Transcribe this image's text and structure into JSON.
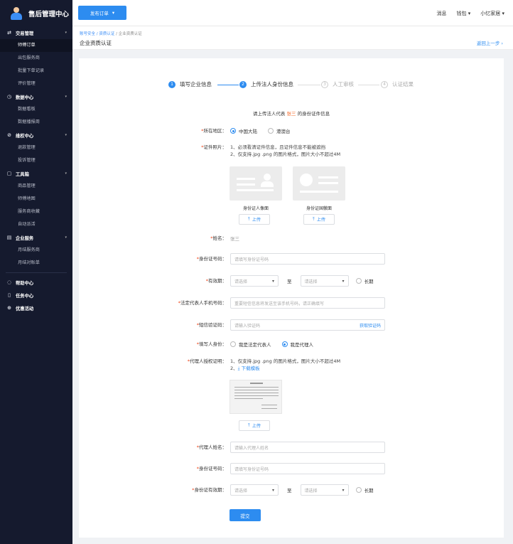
{
  "app_title": "售后管理中心",
  "sidebar": {
    "groups": [
      {
        "icon": "⇄",
        "label": "交易管理",
        "items": [
          "师傅订单",
          "出包服务商",
          "批量下单记录",
          "评价管理"
        ]
      },
      {
        "icon": "◷",
        "label": "数据中心",
        "items": [
          "数据看板",
          "数据播报周"
        ]
      },
      {
        "icon": "⊘",
        "label": "维权中心",
        "items": [
          "退款管理",
          "投诉管理"
        ]
      },
      {
        "icon": "▢",
        "label": "工具箱",
        "items": [
          "商品管理",
          "师傅地图",
          "服务商收藏",
          "自动派活"
        ]
      },
      {
        "icon": "▤",
        "label": "企业服务",
        "items": [
          "月结服务商",
          "月结对账单"
        ]
      }
    ],
    "extra": [
      {
        "icon": "◌",
        "label": "帮助中心"
      },
      {
        "icon": "▯",
        "label": "任务中心"
      },
      {
        "icon": "⊕",
        "label": "优惠活动"
      }
    ]
  },
  "topbar": {
    "publish_label": "发布订单",
    "message": "消息",
    "wallet": "钱包",
    "user": "小忆家居"
  },
  "breadcrumb": {
    "a": "账号安全",
    "b": "资质认证",
    "c": "企业资质认证",
    "sep": " / "
  },
  "page_title": "企业资质认证",
  "back_label": "返回上一步",
  "steps": [
    {
      "num": "1",
      "label": "填写企业信息"
    },
    {
      "num": "2",
      "label": "上传法人身份信息"
    },
    {
      "num": "3",
      "label": "人工审核"
    },
    {
      "num": "4",
      "label": "认证结果"
    }
  ],
  "prompt": {
    "pre": "请上传法人代表",
    "name": "张三",
    "post": "的身份证件信息"
  },
  "form": {
    "region": {
      "label": "所在地区：",
      "opt1": "中国大陆",
      "opt2": "港澳台"
    },
    "photo": {
      "label": "证件照片：",
      "note1": "1、必须看清证件信息，且证件信息不能被遮挡",
      "note2": "2、仅支持.jpg .png 的图片格式，图片大小不超过4M",
      "front": "身份证人像面",
      "back": "身份证国徽面",
      "upload": "上传"
    },
    "name": {
      "label": "姓名：",
      "value": "张三"
    },
    "id_no": {
      "label": "身份证号码：",
      "placeholder": "请填写身份证号码"
    },
    "validity": {
      "label": "有效期：",
      "placeholder": "请选择",
      "to": "至",
      "long": "长期"
    },
    "phone": {
      "label": "法定代表人手机号码：",
      "placeholder": "重要短信信息将发送至该手机号码，请正确填写"
    },
    "sms": {
      "label": "短信验证码：",
      "placeholder": "请输入验证码",
      "btn": "获取验证码"
    },
    "identity": {
      "label": "填写人身份：",
      "opt1": "我是法定代表人",
      "opt2": "我是代理人"
    },
    "auth": {
      "label": "代理人授权证明：",
      "note1": "1、仅支持.jpg .png 的图片格式，图片大小不超过4M",
      "note2": "2、",
      "download": "下载模板",
      "upload": "上传"
    },
    "agent_name": {
      "label": "代理人姓名：",
      "placeholder": "请输入代理人姓名"
    },
    "agent_id": {
      "label": "身份证号码：",
      "placeholder": "请填写身份证号码"
    },
    "agent_validity": {
      "label": "身份证有效期：",
      "placeholder": "请选择",
      "to": "至",
      "long": "长期"
    },
    "submit": "提交"
  }
}
